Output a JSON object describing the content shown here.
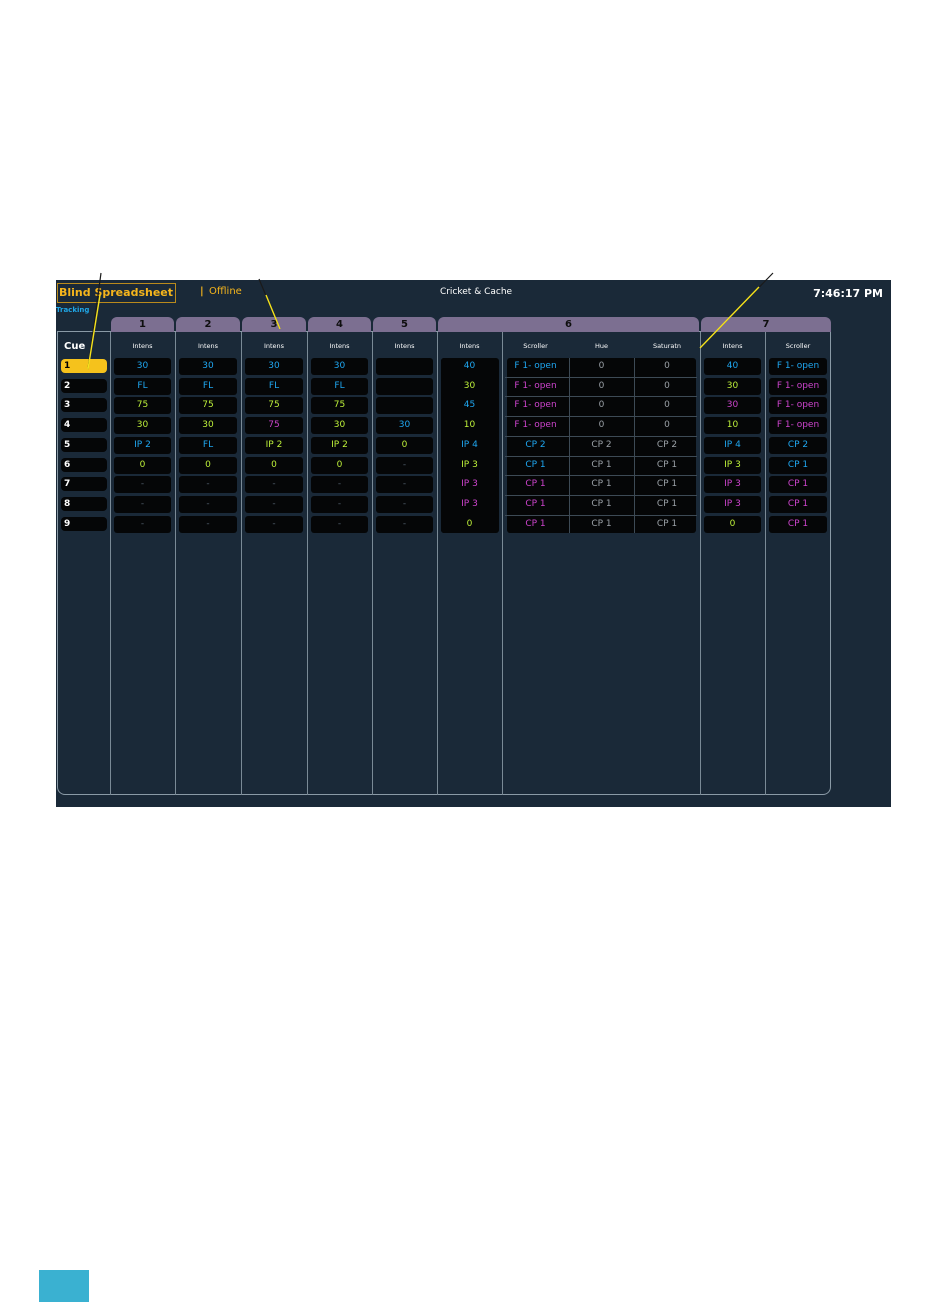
{
  "header": {
    "tab_title": "Blind Spreadsheet",
    "separator": "|",
    "status": "Offline",
    "show_name": "Cricket & Cache",
    "clock": "7:46:17 PM",
    "mode": "Tracking"
  },
  "cue_column": {
    "header": "Cue",
    "selected_index": 0,
    "cues": [
      "1",
      "2",
      "3",
      "4",
      "5",
      "6",
      "7",
      "8",
      "9"
    ]
  },
  "channels": [
    {
      "label": "1",
      "columns": [
        {
          "param": "Intens",
          "values": [
            "30",
            "FL",
            "75",
            "30",
            "IP 2",
            "0",
            "-",
            "-",
            "-"
          ]
        }
      ]
    },
    {
      "label": "2",
      "columns": [
        {
          "param": "Intens",
          "values": [
            "30",
            "FL",
            "75",
            "30",
            "FL",
            "0",
            "-",
            "-",
            "-"
          ]
        }
      ]
    },
    {
      "label": "3",
      "columns": [
        {
          "param": "Intens",
          "values": [
            "30",
            "FL",
            "75",
            "75",
            "IP 2",
            "0",
            "-",
            "-",
            "-"
          ]
        }
      ]
    },
    {
      "label": "4",
      "columns": [
        {
          "param": "Intens",
          "values": [
            "30",
            "FL",
            "75",
            "30",
            "IP 2",
            "0",
            "-",
            "-",
            "-"
          ]
        }
      ]
    },
    {
      "label": "5",
      "columns": [
        {
          "param": "Intens",
          "values": [
            "",
            "",
            "",
            "30",
            "0",
            "-",
            "-",
            "-",
            "-"
          ]
        }
      ]
    },
    {
      "label": "6",
      "columns": [
        {
          "param": "Intens",
          "values": [
            "40",
            "30",
            "45",
            "10",
            "IP 4",
            "IP 3",
            "IP 3",
            "IP 3",
            "0"
          ]
        },
        {
          "param": "Scroller",
          "values": [
            "F 1- open",
            "F 1- open",
            "F 1- open",
            "F 1- open",
            "CP 2",
            "CP 1",
            "CP 1",
            "CP 1",
            "CP 1"
          ]
        },
        {
          "param": "Hue",
          "values": [
            "0",
            "0",
            "0",
            "0",
            "CP 2",
            "CP 1",
            "CP 1",
            "CP 1",
            "CP 1"
          ]
        },
        {
          "param": "Saturatn",
          "values": [
            "0",
            "0",
            "0",
            "0",
            "CP 2",
            "CP 1",
            "CP 1",
            "CP 1",
            "CP 1"
          ]
        }
      ]
    },
    {
      "label": "7",
      "columns": [
        {
          "param": "Intens",
          "values": [
            "40",
            "30",
            "30",
            "10",
            "IP 4",
            "IP 3",
            "IP 3",
            "IP 3",
            "0"
          ]
        },
        {
          "param": "Scroller",
          "values": [
            "F 1- open",
            "F 1- open",
            "F 1- open",
            "F 1- open",
            "CP 2",
            "CP 1",
            "CP 1",
            "CP 1",
            "CP 1"
          ]
        }
      ]
    }
  ],
  "colors": {
    "background": "#1a2938",
    "accent": "#f5b51c",
    "blue": "#1fa6f0",
    "green": "#bff23a",
    "magenta": "#cc44cc",
    "gray": "#9aa0a6",
    "tracked": "#52606c",
    "channel_tab": "#7c6f91"
  }
}
